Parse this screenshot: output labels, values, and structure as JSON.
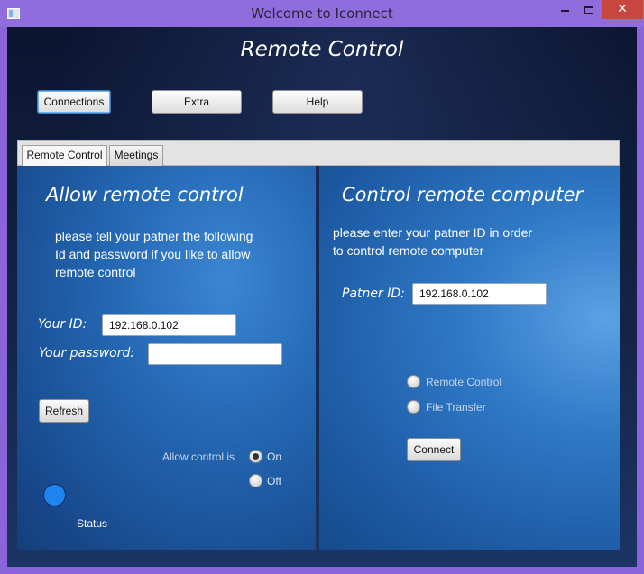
{
  "window": {
    "title": "Welcome to Iconnect",
    "close_glyph": "✕"
  },
  "app": {
    "title": "Remote Control"
  },
  "toolbar": {
    "connections_label": "Connections",
    "extra_label": "Extra",
    "help_label": "Help"
  },
  "tabs": [
    {
      "label": "Remote Control",
      "selected": true
    },
    {
      "label": "Meetings",
      "selected": false
    }
  ],
  "allow_panel": {
    "heading": "Allow remote control",
    "info_lines": [
      "please tell your patner the following",
      "Id and password if you like to allow",
      "remote control"
    ],
    "your_id_label": "Your ID:",
    "your_id_value": "192.168.0.102",
    "password_label": "Your password:",
    "password_value": "",
    "refresh_label": "Refresh",
    "allow_control_label": "Allow control is",
    "on_label": "On",
    "off_label": "Off",
    "allow_control_selected": "On",
    "status_label": "Status",
    "status_color": "#1e84f2"
  },
  "control_panel": {
    "heading": "Control remote computer",
    "info_lines": [
      "please enter your patner ID in order",
      "to control remote computer"
    ],
    "partner_id_label": "Patner ID:",
    "partner_id_value": "192.168.0.102",
    "mode_remote_label": "Remote Control",
    "mode_file_label": "File Transfer",
    "connect_label": "Connect"
  },
  "colors": {
    "titlebar": "#8f6ddc",
    "close_button": "#c7463f",
    "panel_blue": "#2467b3"
  }
}
